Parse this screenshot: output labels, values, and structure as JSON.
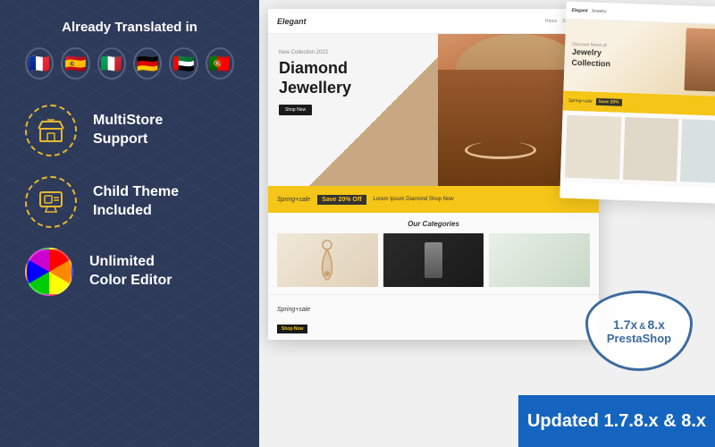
{
  "left": {
    "translated_title": "Already Translated in",
    "flags": [
      {
        "name": "france",
        "emoji": "🇫🇷"
      },
      {
        "name": "spain",
        "emoji": "🇪🇸"
      },
      {
        "name": "italy",
        "emoji": "🇮🇹"
      },
      {
        "name": "germany",
        "emoji": "🇩🇪"
      },
      {
        "name": "uae",
        "emoji": "🇦🇪"
      },
      {
        "name": "portugal",
        "emoji": "🇵🇹"
      }
    ],
    "features": [
      {
        "id": "multistore",
        "label_line1": "MultiStore",
        "label_line2": "Support",
        "icon": "store"
      },
      {
        "id": "child-theme",
        "label_line1": "Child Theme",
        "label_line2": "Included",
        "icon": "monitor"
      },
      {
        "id": "unlimited",
        "label_line1": "Unlimited",
        "label_line2": "Color Editor",
        "icon": "color-wheel"
      }
    ]
  },
  "right": {
    "mockup": {
      "logo": "Elegant",
      "hero_subtitle": "New Collection 2022",
      "hero_title_line1": "Diamond",
      "hero_title_line2": "Jewellery",
      "hero_btn": "Shop Now",
      "spring_label": "Spring+sale",
      "sale_badge": "Save 20% Off",
      "sale_desc": "Lorem Ipsum Diamond Shop Now",
      "categories_title": "Our Categories"
    },
    "badge": {
      "version": "1.7x",
      "amp": "&",
      "version2": "8.x",
      "name": "PrestaShop"
    },
    "updated_banner": "Updated 1.7.8.x & 8.x"
  }
}
